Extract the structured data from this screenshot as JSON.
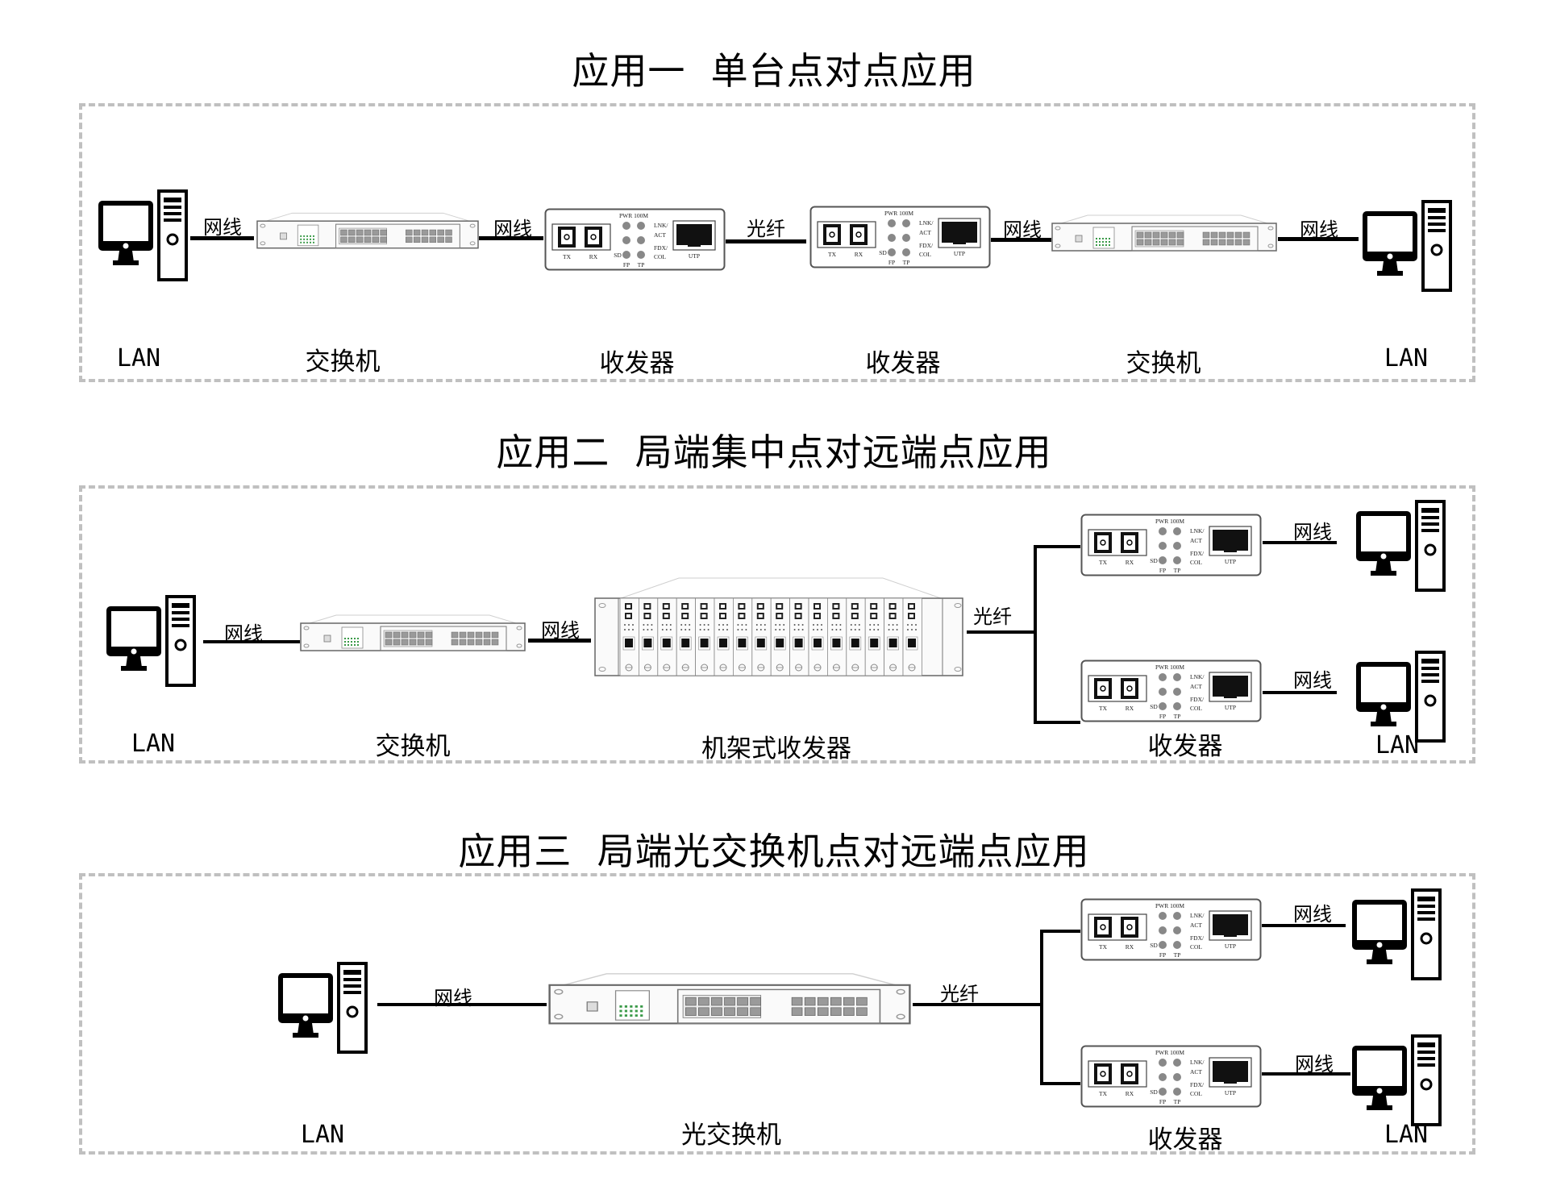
{
  "titles": {
    "app1": "应用一  单台点对点应用",
    "app2": "应用二  局端集中点对远端点应用",
    "app3": "应用三  局端光交换机点对远端点应用"
  },
  "labels": {
    "lan": "LAN",
    "switch": "交换机",
    "transceiver": "收发器",
    "rack_transceiver": "机架式收发器",
    "optical_switch": "光交换机",
    "network_cable": "网线",
    "fiber": "光纤"
  },
  "device_text": {
    "tx": "TX",
    "rx": "RX",
    "pwr": "PWR",
    "m100": "100M",
    "lnk": "LNK/",
    "act": "ACT",
    "fdx": "FDX/",
    "col": "COL",
    "sd": "SD",
    "fp": "FP",
    "tp": "TP",
    "utp": "UTP"
  },
  "app1": {
    "chain": [
      "LAN",
      "交换机",
      "收发器",
      "收发器",
      "交换机",
      "LAN"
    ],
    "links": [
      "网线",
      "网线",
      "光纤",
      "网线",
      "网线"
    ]
  },
  "app2": {
    "central": [
      "LAN",
      "交换机",
      "机架式收发器"
    ],
    "central_links": [
      "网线",
      "网线"
    ],
    "trunk_link": "光纤",
    "remote": [
      "收发器",
      "LAN"
    ],
    "remote_links": [
      "网线",
      "网线"
    ],
    "rack_card_count": 16
  },
  "app3": {
    "central": [
      "LAN",
      "光交换机"
    ],
    "central_links": [
      "网线"
    ],
    "trunk_link": "光纤",
    "remote": [
      "收发器",
      "LAN"
    ],
    "remote_links": [
      "网线",
      "网线"
    ]
  },
  "colors": {
    "border": "#c0c0c0",
    "line": "#000000",
    "device_outline": "#555555",
    "led_green": "#2e8b3a"
  }
}
